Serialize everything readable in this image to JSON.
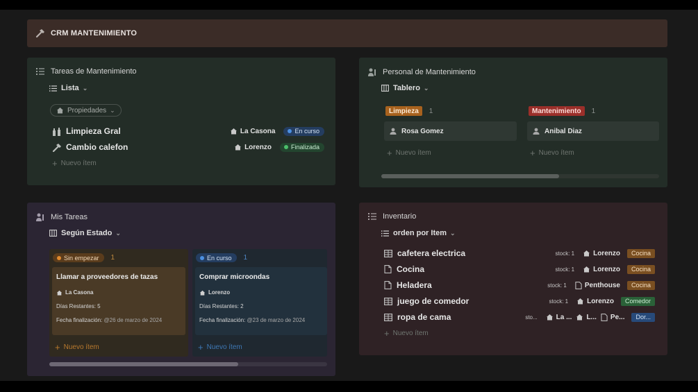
{
  "header": {
    "title": "CRM MANTENIMIENTO",
    "icon": "hammer-icon"
  },
  "tareas": {
    "title": "Tareas de Mantenimiento",
    "view": "Lista",
    "properties_label": "Propiedades",
    "rows": [
      {
        "icon": "spray-icon",
        "name": "Limpieza Gral",
        "location": "La Casona",
        "status": "En curso"
      },
      {
        "icon": "hammer-icon",
        "name": "Cambio calefon",
        "location": "Lorenzo",
        "status": "Finalizada"
      }
    ],
    "new_item": "Nuevo ítem"
  },
  "personal": {
    "title": "Personal de Mantenimiento",
    "view": "Tablero",
    "groups": [
      {
        "label": "Limpieza",
        "count": "1",
        "card": "Rosa Gomez",
        "new_item": "Nuevo ítem"
      },
      {
        "label": "Mantenimiento",
        "count": "1",
        "card": "Anibal Diaz",
        "new_item": "Nuevo ítem"
      }
    ],
    "scroll_fraction": 0.64
  },
  "mis_tareas": {
    "title": "Mis Tareas",
    "view": "Según Estado",
    "columns": [
      {
        "status": "Sin empezar",
        "count": "1",
        "card": {
          "title": "Llamar a proveedores de tazas",
          "location": "La Casona",
          "dias_label": "Días Restantes: 5",
          "fecha_label": "Fecha finalización:",
          "fecha_value": "@26 de marzo de 2024"
        },
        "new_item": "Nuevo ítem"
      },
      {
        "status": "En curso",
        "count": "1",
        "card": {
          "title": "Comprar microondas",
          "location": "Lorenzo",
          "dias_label": "Días Restantes: 2",
          "fecha_label": "Fecha finalización:",
          "fecha_value": "@23 de marzo de 2024"
        },
        "new_item": "Nuevo ítem"
      }
    ],
    "scroll_fraction": 0.68
  },
  "inventario": {
    "title": "Inventario",
    "view": "orden por Item",
    "rows": [
      {
        "icon": "table-icon",
        "name": "cafetera electrica",
        "stock": "stock: 1",
        "locations": [
          "Lorenzo"
        ],
        "tag": "Cocina"
      },
      {
        "icon": "page-icon",
        "name": "Cocina",
        "stock": "stock: 1",
        "locations": [
          "Lorenzo"
        ],
        "tag": "Cocina"
      },
      {
        "icon": "page-icon",
        "name": "Heladera",
        "stock": "stock: 1",
        "locations": [
          "Penthouse"
        ],
        "tag": "Cocina"
      },
      {
        "icon": "table-icon",
        "name": "juego de comedor",
        "stock": "stock: 1",
        "locations": [
          "Lorenzo"
        ],
        "tag": "Comedor"
      },
      {
        "icon": "table-icon",
        "name": "ropa de cama",
        "stock": "sto...",
        "locations": [
          "La ...",
          "L...",
          "Pe..."
        ],
        "tag": "Dor..."
      }
    ],
    "new_item": "Nuevo ítem"
  },
  "colors": {
    "accent_blue": "#4c90e0",
    "accent_green": "#4cbf6b",
    "accent_orange": "#e08a2e"
  }
}
